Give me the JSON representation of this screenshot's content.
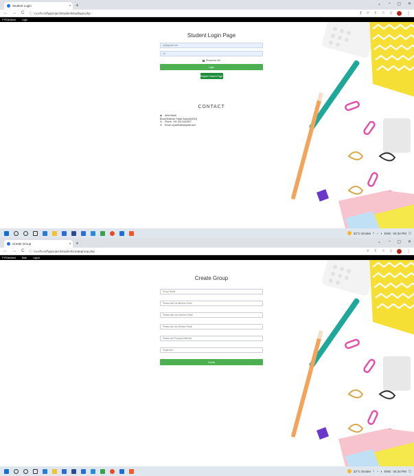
{
  "login": {
    "tab_title": "Student Login",
    "url_host": "localhost",
    "url_path": "/fypproject/student/studlogin.php",
    "nav": [
      "FYPDashbord",
      "Login"
    ],
    "page_title": "Student Login Page",
    "username_value": "roll@gmail.com",
    "password_value": "••••",
    "remember_label": "Remember Me",
    "login_button": "Login",
    "register_button": "Register Student Page",
    "contact_title": "CONTACT",
    "contact": {
      "name": "Arifa Habib",
      "address": "Block/Shahrah Faisal Karachi(2022)",
      "phone": "Phone: +92-333-3432847",
      "email": "Email: mywebsite@gmail.com"
    },
    "taskbar": {
      "weather": "32°C Smoke",
      "lang": "ENG",
      "time": "04:34 PM"
    }
  },
  "group": {
    "tab_title": "Create Group",
    "url_host": "localhost",
    "url_path": "/fypproject/student/creategroup.php",
    "nav": [
      "FYPDashbord",
      "Back",
      "Logout"
    ],
    "page_title": "Create Group",
    "fields": [
      "Group Name",
      "Please add 1st Member Email",
      "Please add 2nd Member Email",
      "Please add 3rd Member Email",
      "Please add Proposal title/Idea",
      "Supervisor"
    ],
    "submit_button": "Submit",
    "taskbar": {
      "weather": "32°C Smoke",
      "lang": "ENG",
      "time": "04:34 PM"
    }
  },
  "colors": {
    "accent_green": "#4caf50",
    "register_green": "#1e8c3a",
    "nav_black": "#000000",
    "taskbar": "#dfe6ee"
  }
}
